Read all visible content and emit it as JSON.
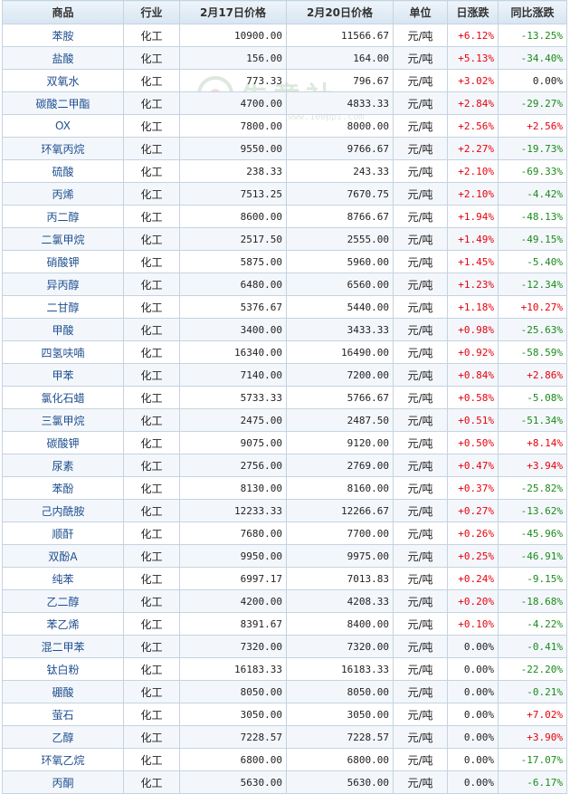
{
  "table": {
    "headers": {
      "name": "商品",
      "industry": "行业",
      "price1": "2月17日价格",
      "price2": "2月20日价格",
      "unit": "单位",
      "daily": "日涨跌",
      "yoy": "同比涨跌"
    },
    "rows": [
      {
        "name": "苯胺",
        "industry": "化工",
        "p1": "10900.00",
        "p2": "11566.67",
        "unit": "元/吨",
        "daily": "+6.12%",
        "yoy": "-13.25%"
      },
      {
        "name": "盐酸",
        "industry": "化工",
        "p1": "156.00",
        "p2": "164.00",
        "unit": "元/吨",
        "daily": "+5.13%",
        "yoy": "-34.40%"
      },
      {
        "name": "双氧水",
        "industry": "化工",
        "p1": "773.33",
        "p2": "796.67",
        "unit": "元/吨",
        "daily": "+3.02%",
        "yoy": "0.00%"
      },
      {
        "name": "碳酸二甲酯",
        "industry": "化工",
        "p1": "4700.00",
        "p2": "4833.33",
        "unit": "元/吨",
        "daily": "+2.84%",
        "yoy": "-29.27%"
      },
      {
        "name": "OX",
        "industry": "化工",
        "p1": "7800.00",
        "p2": "8000.00",
        "unit": "元/吨",
        "daily": "+2.56%",
        "yoy": "+2.56%"
      },
      {
        "name": "环氧丙烷",
        "industry": "化工",
        "p1": "9550.00",
        "p2": "9766.67",
        "unit": "元/吨",
        "daily": "+2.27%",
        "yoy": "-19.73%"
      },
      {
        "name": "硫酸",
        "industry": "化工",
        "p1": "238.33",
        "p2": "243.33",
        "unit": "元/吨",
        "daily": "+2.10%",
        "yoy": "-69.33%"
      },
      {
        "name": "丙烯",
        "industry": "化工",
        "p1": "7513.25",
        "p2": "7670.75",
        "unit": "元/吨",
        "daily": "+2.10%",
        "yoy": "-4.42%"
      },
      {
        "name": "丙二醇",
        "industry": "化工",
        "p1": "8600.00",
        "p2": "8766.67",
        "unit": "元/吨",
        "daily": "+1.94%",
        "yoy": "-48.13%"
      },
      {
        "name": "二氯甲烷",
        "industry": "化工",
        "p1": "2517.50",
        "p2": "2555.00",
        "unit": "元/吨",
        "daily": "+1.49%",
        "yoy": "-49.15%"
      },
      {
        "name": "硝酸钾",
        "industry": "化工",
        "p1": "5875.00",
        "p2": "5960.00",
        "unit": "元/吨",
        "daily": "+1.45%",
        "yoy": "-5.40%"
      },
      {
        "name": "异丙醇",
        "industry": "化工",
        "p1": "6480.00",
        "p2": "6560.00",
        "unit": "元/吨",
        "daily": "+1.23%",
        "yoy": "-12.34%"
      },
      {
        "name": "二甘醇",
        "industry": "化工",
        "p1": "5376.67",
        "p2": "5440.00",
        "unit": "元/吨",
        "daily": "+1.18%",
        "yoy": "+10.27%"
      },
      {
        "name": "甲酸",
        "industry": "化工",
        "p1": "3400.00",
        "p2": "3433.33",
        "unit": "元/吨",
        "daily": "+0.98%",
        "yoy": "-25.63%"
      },
      {
        "name": "四氢呋喃",
        "industry": "化工",
        "p1": "16340.00",
        "p2": "16490.00",
        "unit": "元/吨",
        "daily": "+0.92%",
        "yoy": "-58.59%"
      },
      {
        "name": "甲苯",
        "industry": "化工",
        "p1": "7140.00",
        "p2": "7200.00",
        "unit": "元/吨",
        "daily": "+0.84%",
        "yoy": "+2.86%"
      },
      {
        "name": "氯化石蜡",
        "industry": "化工",
        "p1": "5733.33",
        "p2": "5766.67",
        "unit": "元/吨",
        "daily": "+0.58%",
        "yoy": "-5.08%"
      },
      {
        "name": "三氯甲烷",
        "industry": "化工",
        "p1": "2475.00",
        "p2": "2487.50",
        "unit": "元/吨",
        "daily": "+0.51%",
        "yoy": "-51.34%"
      },
      {
        "name": "碳酸钾",
        "industry": "化工",
        "p1": "9075.00",
        "p2": "9120.00",
        "unit": "元/吨",
        "daily": "+0.50%",
        "yoy": "+8.14%"
      },
      {
        "name": "尿素",
        "industry": "化工",
        "p1": "2756.00",
        "p2": "2769.00",
        "unit": "元/吨",
        "daily": "+0.47%",
        "yoy": "+3.94%"
      },
      {
        "name": "苯酚",
        "industry": "化工",
        "p1": "8130.00",
        "p2": "8160.00",
        "unit": "元/吨",
        "daily": "+0.37%",
        "yoy": "-25.82%"
      },
      {
        "name": "己内酰胺",
        "industry": "化工",
        "p1": "12233.33",
        "p2": "12266.67",
        "unit": "元/吨",
        "daily": "+0.27%",
        "yoy": "-13.62%"
      },
      {
        "name": "顺酐",
        "industry": "化工",
        "p1": "7680.00",
        "p2": "7700.00",
        "unit": "元/吨",
        "daily": "+0.26%",
        "yoy": "-45.96%"
      },
      {
        "name": "双酚A",
        "industry": "化工",
        "p1": "9950.00",
        "p2": "9975.00",
        "unit": "元/吨",
        "daily": "+0.25%",
        "yoy": "-46.91%"
      },
      {
        "name": "纯苯",
        "industry": "化工",
        "p1": "6997.17",
        "p2": "7013.83",
        "unit": "元/吨",
        "daily": "+0.24%",
        "yoy": "-9.15%"
      },
      {
        "name": "乙二醇",
        "industry": "化工",
        "p1": "4200.00",
        "p2": "4208.33",
        "unit": "元/吨",
        "daily": "+0.20%",
        "yoy": "-18.68%"
      },
      {
        "name": "苯乙烯",
        "industry": "化工",
        "p1": "8391.67",
        "p2": "8400.00",
        "unit": "元/吨",
        "daily": "+0.10%",
        "yoy": "-4.22%"
      },
      {
        "name": "混二甲苯",
        "industry": "化工",
        "p1": "7320.00",
        "p2": "7320.00",
        "unit": "元/吨",
        "daily": "0.00%",
        "yoy": "-0.41%"
      },
      {
        "name": "钛白粉",
        "industry": "化工",
        "p1": "16183.33",
        "p2": "16183.33",
        "unit": "元/吨",
        "daily": "0.00%",
        "yoy": "-22.20%"
      },
      {
        "name": "硼酸",
        "industry": "化工",
        "p1": "8050.00",
        "p2": "8050.00",
        "unit": "元/吨",
        "daily": "0.00%",
        "yoy": "-0.21%"
      },
      {
        "name": "萤石",
        "industry": "化工",
        "p1": "3050.00",
        "p2": "3050.00",
        "unit": "元/吨",
        "daily": "0.00%",
        "yoy": "+7.02%"
      },
      {
        "name": "乙醇",
        "industry": "化工",
        "p1": "7228.57",
        "p2": "7228.57",
        "unit": "元/吨",
        "daily": "0.00%",
        "yoy": "+3.90%"
      },
      {
        "name": "环氧乙烷",
        "industry": "化工",
        "p1": "6800.00",
        "p2": "6800.00",
        "unit": "元/吨",
        "daily": "0.00%",
        "yoy": "-17.07%"
      },
      {
        "name": "丙酮",
        "industry": "化工",
        "p1": "5630.00",
        "p2": "5630.00",
        "unit": "元/吨",
        "daily": "0.00%",
        "yoy": "-6.17%"
      }
    ]
  },
  "watermark": {
    "text": "生意社",
    "url": "www.100ppi.com"
  },
  "colors": {
    "up": "#e8000b",
    "down": "#1a8a1a",
    "flat": "#222222",
    "name_link": "#1f4f8f",
    "header_bg": "#dce8f3",
    "border": "#c5d3e0"
  }
}
